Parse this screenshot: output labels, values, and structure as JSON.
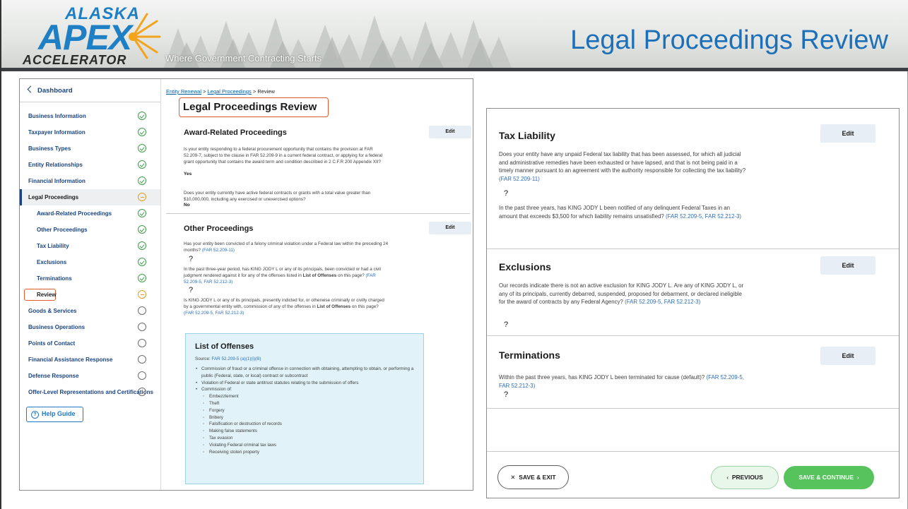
{
  "banner": {
    "logo_top": "ALASKA",
    "logo_main": "APEX",
    "logo_bottom": "ACCELERATOR",
    "tagline": "Where Government Contracting Starts",
    "slide_title": "Legal Proceedings Review"
  },
  "sidenav": {
    "back_label": "Dashboard",
    "items": [
      {
        "label": "Business Information",
        "status": "complete"
      },
      {
        "label": "Taxpayer Information",
        "status": "complete"
      },
      {
        "label": "Business Types",
        "status": "complete"
      },
      {
        "label": "Entity Relationships",
        "status": "complete"
      },
      {
        "label": "Financial Information",
        "status": "complete"
      },
      {
        "label": "Legal Proceedings",
        "status": "in-progress"
      },
      {
        "label": "Award-Related Proceedings",
        "status": "complete"
      },
      {
        "label": "Other Proceedings",
        "status": "complete"
      },
      {
        "label": "Tax Liability",
        "status": "complete"
      },
      {
        "label": "Exclusions",
        "status": "complete"
      },
      {
        "label": "Terminations",
        "status": "complete"
      },
      {
        "label": "Review",
        "status": "in-progress"
      },
      {
        "label": "Goods & Services",
        "status": "not-started"
      },
      {
        "label": "Business Operations",
        "status": "not-started"
      },
      {
        "label": "Points of Contact",
        "status": "not-started"
      },
      {
        "label": "Financial Assistance Response",
        "status": "not-started"
      },
      {
        "label": "Defense Response",
        "status": "not-started"
      },
      {
        "label": "Offer-Level Representations and Certifications",
        "status": "not-started"
      }
    ],
    "help_label": "Help Guide"
  },
  "review": {
    "breadcrumb": [
      "Entity Renewal",
      "Legal Proceedings",
      "Review"
    ],
    "breadcrumb_sep": ">",
    "title": "Legal Proceedings Review",
    "award": {
      "heading": "Award-Related Proceedings",
      "edit": "Edit",
      "q1": "Is your entity responding to a federal procurement opportunity that contains the provision at FAR 52.209-7, subject to the clause in FAR 52.209-9 in a current federal contract, or applying for a federal grant opportunity that contains the award term and condition described in 2 C.F.R 200 Appendix XII?",
      "a1": "Yes",
      "q2": "Does your entity currently have active federal contracts or grants with a total value greater than $10,000,000, including any exercised or unexercised options?",
      "a2": "No"
    },
    "other": {
      "heading": "Other Proceedings",
      "edit": "Edit",
      "q1": "Has your entity been convicted of a felony criminal violation under a Federal law within the preceding 24 months?",
      "q1_ref": "(FAR 52.209-11)",
      "q2": "In the past three-year period, has KING JODY L or any of its principals, been convicted or had a civil judgment rendered against it for any of the offenses listed in",
      "q2_bold": "List of Offenses",
      "q2_tail": "on this page?",
      "q2_ref": "(FAR 52.209-5, FAR 52.212-3)",
      "q3": "Is KING JODY L or any of its principals, presently indicted for, or otherwise criminally or civilly charged by a governmental entity with, commission of any of the offenses in",
      "q3_bold": "List of Offenses",
      "q3_tail": "on this page?",
      "q3_ref": "(FAR 52.209-5, FAR 52.212-3)",
      "answer": "?"
    },
    "offenses": {
      "title": "List of Offenses",
      "source_label": "Source:",
      "source_ref": "FAR 52.209-5 (a)(1)(i)(B)",
      "bullets": [
        "Commission of fraud or a criminal offense in connection with obtaining, attempting to obtain, or performing a public (Federal, state, or local) contract or subcontract",
        "Violation of Federal or state antitrust statutes relating to the submission of offers",
        "Commission of:"
      ],
      "sub_items": [
        "Embezzlement",
        "Theft",
        "Forgery",
        "Bribery",
        "Falsification or destruction of records",
        "Making false statements",
        "Tax evasion",
        "Violating Federal criminal tax laws",
        "Receiving stolen property"
      ]
    }
  },
  "detail": {
    "tax": {
      "heading": "Tax Liability",
      "edit": "Edit",
      "q1": "Does your entity have any unpaid Federal tax liability that has been assessed, for which all judicial and administrative remedies have been exhausted or have lapsed, and that is not being paid in a timely manner pursuant to an agreement with the authority responsible for collecting the tax liability?",
      "q1_ref": "(FAR 52.209-11)",
      "q2": "In the past three years, has KING JODY L been notified of any delinquent Federal Taxes in an amount that exceeds $3,500 for which liability remains unsatisfied?",
      "q2_ref": "(FAR 52.209-5, FAR 52.212-3)",
      "answer": "?"
    },
    "exclusions": {
      "heading": "Exclusions",
      "edit": "Edit",
      "q1": "Our records indicate there is not an active exclusion for KING JODY L. Are any of KING JODY L, or any of its principals, currently debarred, suspended, proposed for debarment, or declared ineligible for the award of contracts by any Federal Agency?",
      "q1_ref": "(FAR 52.209-5, FAR 52.212-3)",
      "answer": "?"
    },
    "terminations": {
      "heading": "Terminations",
      "edit": "Edit",
      "q1": "Within the past three years, has KING JODY L been terminated for cause (default)?",
      "q1_ref": "(FAR 52.209-5, FAR 52.212-3)",
      "answer": "?"
    },
    "buttons": {
      "save_exit": "SAVE & EXIT",
      "previous": "PREVIOUS",
      "save_continue": "SAVE & CONTINUE"
    }
  },
  "colors": {
    "brand_blue": "#1d6fb8",
    "highlight_orange": "#e35d2a",
    "complete_green": "#3e9e4a",
    "in_progress_amber": "#e0a020",
    "continue_green": "#56c35c"
  }
}
